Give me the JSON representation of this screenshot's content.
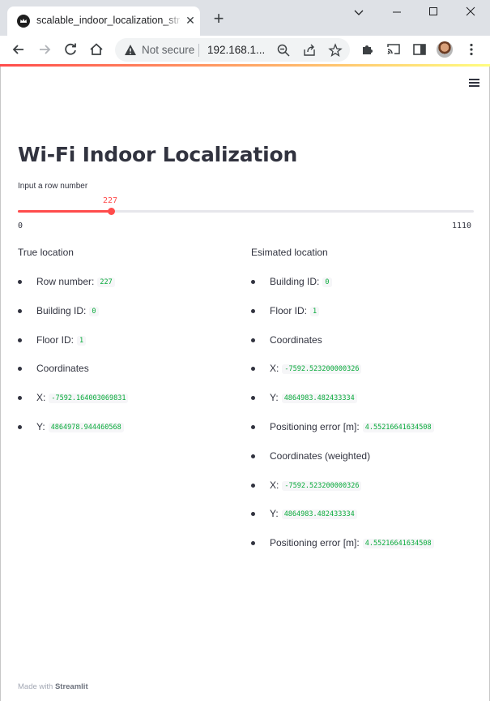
{
  "browser": {
    "tab_title": "scalable_indoor_localization_streamlit",
    "tab_close": "✕",
    "new_tab": "+",
    "window_controls": {
      "minimize": "⌄",
      "restore": "–",
      "maximize": "□",
      "close": "✕"
    },
    "omnibox": {
      "security_label": "Not secure",
      "url": "192.168.1..."
    },
    "icons": [
      "back-icon",
      "forward-icon",
      "reload-icon",
      "home-icon",
      "warning-icon",
      "zoom-icon",
      "share-icon",
      "star-icon",
      "extensions-icon",
      "cast-icon",
      "side-panel-icon",
      "profile-avatar",
      "more-menu-icon"
    ]
  },
  "app": {
    "title": "Wi-Fi Indoor Localization",
    "accent_color": "#ff4b4b",
    "code_color": "#09ab3b",
    "slider": {
      "label": "Input a row number",
      "value": 227,
      "value_text": "227",
      "min": 0,
      "min_text": "0",
      "max": 1110,
      "max_text": "1110"
    },
    "true_location": {
      "heading": "True location",
      "items": [
        {
          "label": "Row number:",
          "value": "227"
        },
        {
          "label": "Building ID:",
          "value": "0"
        },
        {
          "label": "Floor ID:",
          "value": "1"
        },
        {
          "label": "Coordinates",
          "value": ""
        },
        {
          "label": "X:",
          "value": "-7592.164003069831"
        },
        {
          "label": "Y:",
          "value": "4864978.944460568"
        }
      ]
    },
    "estimated_location": {
      "heading": "Esimated location",
      "items": [
        {
          "label": "Building ID:",
          "value": "0"
        },
        {
          "label": "Floor ID:",
          "value": "1"
        },
        {
          "label": "Coordinates",
          "value": ""
        },
        {
          "label": "X:",
          "value": "-7592.523200000326"
        },
        {
          "label": "Y:",
          "value": "4864983.482433334"
        },
        {
          "label": "Positioning error [m]:",
          "value": "4.55216641634508"
        },
        {
          "label": "Coordinates (weighted)",
          "value": ""
        },
        {
          "label": "X:",
          "value": "-7592.523200000326"
        },
        {
          "label": "Y:",
          "value": "4864983.482433334"
        },
        {
          "label": "Positioning error [m]:",
          "value": "4.55216641634508"
        }
      ]
    },
    "footer": {
      "prefix": "Made with",
      "brand": "Streamlit"
    }
  }
}
